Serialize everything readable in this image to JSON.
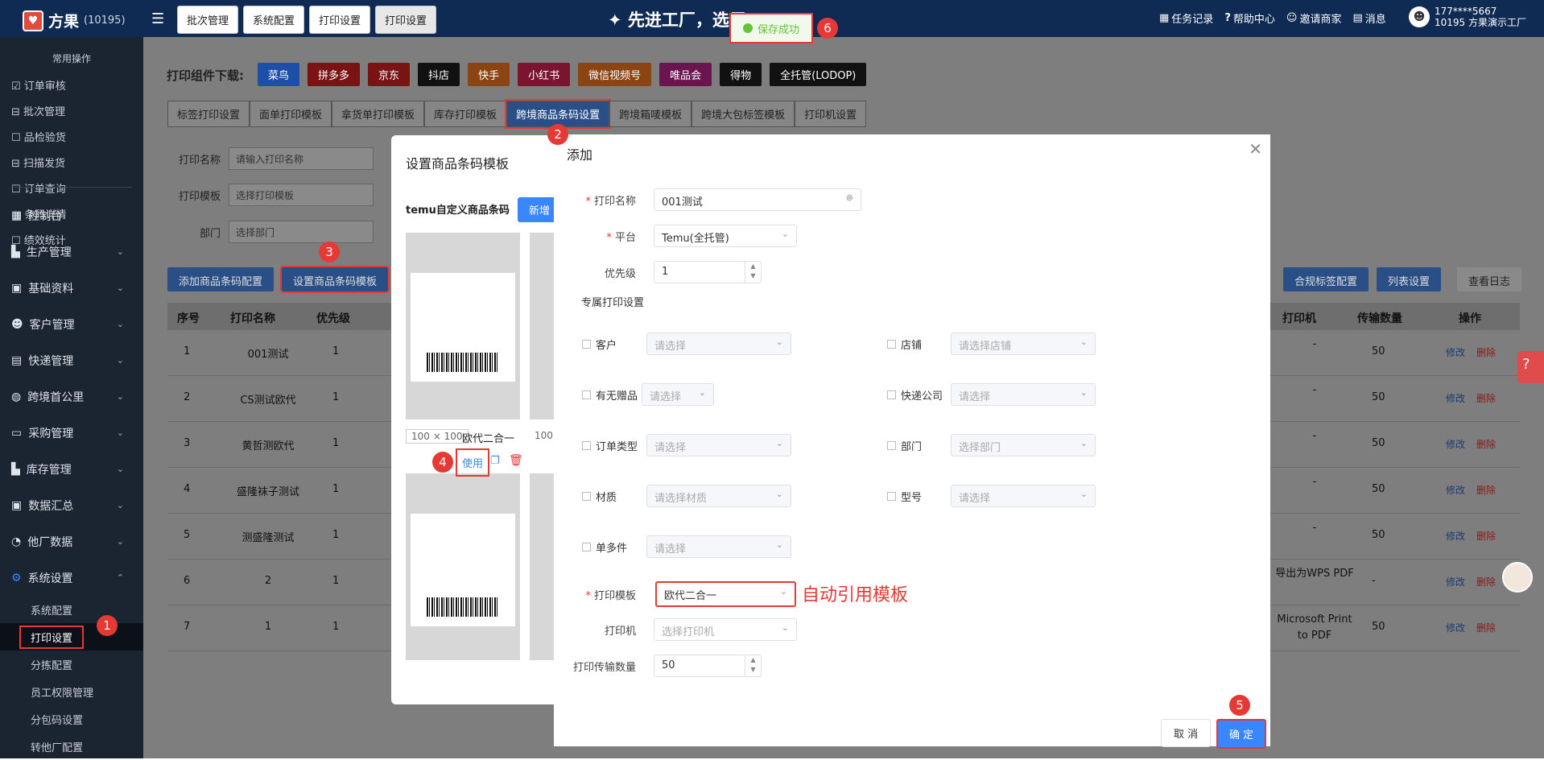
{
  "app": {
    "name": "方果",
    "id": "(10195)",
    "banner": "先进工厂，选用"
  },
  "topnav": [
    "批次管理",
    "系统配置",
    "打印设置",
    "打印设置"
  ],
  "top_right": [
    "任务记录",
    "帮助中心",
    "邀请商家",
    "消息"
  ],
  "user": {
    "phone": "177****5667",
    "company": "10195 方果演示工厂"
  },
  "toast": "保存成功",
  "sidebar": {
    "common": "常用操作",
    "quick": [
      "订单审核",
      "批次管理",
      "品检验货",
      "扫描发货",
      "订单查询",
      "条码详情",
      "绩效统计"
    ],
    "menu": [
      "控制台",
      "生产管理",
      "基础资料",
      "客户管理",
      "快递管理",
      "跨境首公里",
      "采购管理",
      "库存管理",
      "数据汇总",
      "他厂数据",
      "系统设置"
    ],
    "sub": [
      "系统配置",
      "打印设置",
      "分拣配置",
      "员工权限管理",
      "分包码设置",
      "转他厂配置"
    ]
  },
  "download": {
    "label": "打印组件下载:",
    "buttons": [
      "菜鸟",
      "拼多多",
      "京东",
      "抖店",
      "快手",
      "小红书",
      "微信视频号",
      "唯品会",
      "得物",
      "全托管(LODOP)"
    ]
  },
  "tabs": [
    "标签打印设置",
    "面单打印模板",
    "拿货单打印模板",
    "库存打印模板",
    "跨境商品条码设置",
    "跨境箱唛模板",
    "跨境大包标签模板",
    "打印机设置"
  ],
  "filters": {
    "name_label": "打印名称",
    "name_ph": "请输入打印名称",
    "tpl_label": "打印模板",
    "tpl_ph": "选择打印模板",
    "dept_label": "部门",
    "dept_ph": "选择部门"
  },
  "actions": {
    "add": "添加商品条码配置",
    "set": "设置商品条码模板",
    "merge": "合规标签配置",
    "list": "列表设置",
    "log": "查看日志"
  },
  "table": {
    "headers": [
      "序号",
      "打印名称",
      "优先级",
      "打印机",
      "传输数量",
      "操作"
    ],
    "rows": [
      {
        "no": "1",
        "name": "001测试",
        "pri": "1",
        "printer": "-",
        "qty": "50"
      },
      {
        "no": "2",
        "name": "CS测试欧代",
        "pri": "1",
        "printer": "-",
        "qty": "50"
      },
      {
        "no": "3",
        "name": "黄哲测欧代",
        "pri": "1",
        "printer": "-",
        "qty": "50"
      },
      {
        "no": "4",
        "name": "盛隆袜子测试",
        "pri": "1",
        "printer": "-",
        "qty": "50"
      },
      {
        "no": "5",
        "name": "测盛隆测试",
        "pri": "1",
        "printer": "-",
        "qty": "50"
      },
      {
        "no": "6",
        "name": "2",
        "pri": "1",
        "printer": "导出为WPS PDF",
        "qty": "-"
      },
      {
        "no": "7",
        "name": "1",
        "pri": "1",
        "printer": "Microsoft Print to PDF",
        "qty": "50"
      }
    ],
    "edit": "修改",
    "del": "删除"
  },
  "tpl_modal": {
    "title": "设置商品条码模板",
    "sub": "temu自定义商品条码",
    "new": "新增",
    "size": "100 × 100",
    "size2": "100",
    "name": "欧代二合一",
    "use": "使用"
  },
  "add_modal": {
    "title": "添加",
    "name_label": "打印名称",
    "name_val": "001测试",
    "platform_label": "平台",
    "platform_val": "Temu(全托管)",
    "priority_label": "优先级",
    "priority_val": "1",
    "section": "专属打印设置",
    "checks": [
      {
        "label": "客户",
        "ph": "请选择"
      },
      {
        "label": "店铺",
        "ph": "请选择店铺"
      },
      {
        "label": "有无赠品",
        "ph": "请选择"
      },
      {
        "label": "快递公司",
        "ph": "请选择"
      },
      {
        "label": "订单类型",
        "ph": "请选择"
      },
      {
        "label": "部门",
        "ph": "选择部门"
      },
      {
        "label": "材质",
        "ph": "请选择材质"
      },
      {
        "label": "型号",
        "ph": "请选择"
      },
      {
        "label": "单多件",
        "ph": "请选择"
      }
    ],
    "tpl_label": "打印模板",
    "tpl_val": "欧代二合一",
    "printer_label": "打印机",
    "printer_ph": "选择打印机",
    "qty_label": "打印传输数量",
    "qty_val": "50",
    "note": "自动引用模板",
    "cancel": "取 消",
    "ok": "确 定"
  },
  "badges": [
    "1",
    "2",
    "3",
    "4",
    "5",
    "6"
  ]
}
